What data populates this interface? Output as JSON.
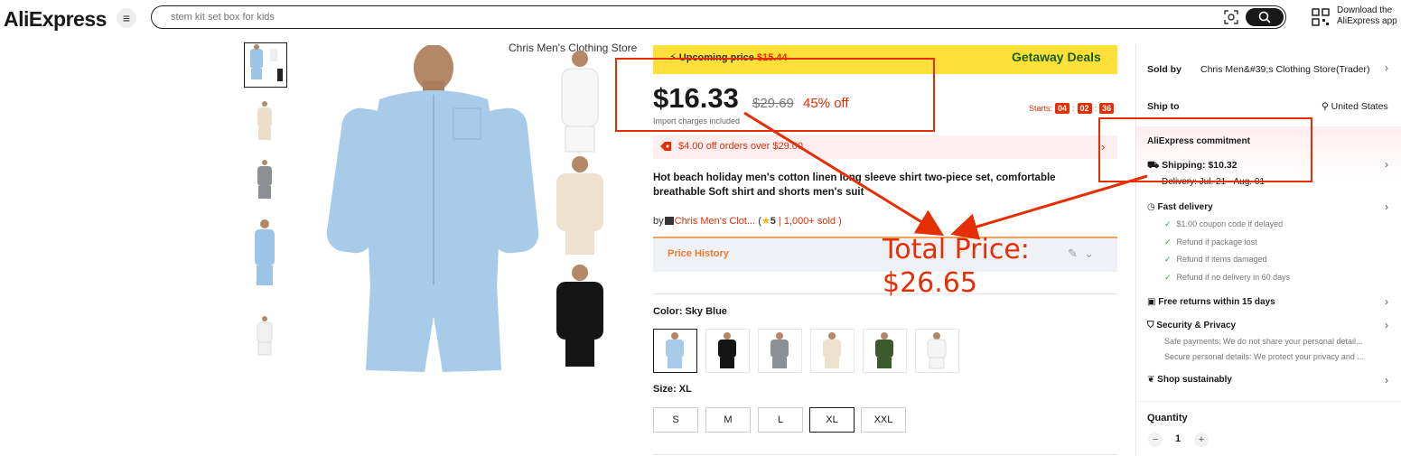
{
  "header": {
    "logo": "AliExpress",
    "search_placeholder": "stem kit set box for kids",
    "download_line1": "Download the",
    "download_line2": "AliExpress app"
  },
  "gallery": {
    "store_caption": "Chris Men's Clothing Store",
    "main_colors": [
      "sky-blue",
      "white",
      "beige",
      "black"
    ]
  },
  "product": {
    "upcoming_label": "Upcoming price",
    "upcoming_price": "$15.44",
    "promo": "Getaway Deals",
    "price": "$16.33",
    "original_price": "$29.69",
    "discount": "45% off",
    "import_note": "Import charges included",
    "starts_label": "Starts:",
    "timer": [
      "04",
      "02",
      "36"
    ],
    "coupon": "$4.00 off orders over $29.00",
    "title": "Hot beach holiday men's cotton linen long sleeve shirt two-piece set, comfortable breathable Soft shirt and shorts men's suit",
    "by": "by",
    "store": "Chris Men's Clot...",
    "rating_open": " (",
    "rating": "5",
    "sold": " | 1,000+ sold )",
    "price_history": "Price History",
    "color_label": "Color: Sky Blue",
    "colors": [
      "sky blue",
      "black",
      "gray",
      "beige",
      "army green",
      "white"
    ],
    "size_label": "Size: XL",
    "sizes": [
      "S",
      "M",
      "L",
      "XL",
      "XXL"
    ],
    "selected_size": "XL"
  },
  "side": {
    "sold_by_label": "Sold by",
    "sold_by_value": "Chris Men&#39;s Clothing Store(Trader)",
    "ship_to_label": "Ship to",
    "ship_to_value": "United States",
    "commitment": "AliExpress commitment",
    "shipping": "Shipping: $10.32",
    "delivery": "Delivery: Jul. 21 - Aug. 01",
    "fast_delivery": "Fast delivery",
    "fast_items": [
      "$1.00 coupon code if delayed",
      "Refund if package lost",
      "Refund if items damaged",
      "Refund if no delivery in 60 days"
    ],
    "free_returns": "Free returns within 15 days",
    "security": "Security & Privacy",
    "security_items": [
      "Safe payments: We do not share your personal detail...",
      "Secure personal details: We protect your privacy and ..."
    ],
    "sustainable": "Shop sustainably",
    "quantity_label": "Quantity",
    "quantity": "1"
  },
  "annotation": {
    "line1": "Total Price:",
    "line2": "$26.65",
    "color": "#e62e04"
  }
}
